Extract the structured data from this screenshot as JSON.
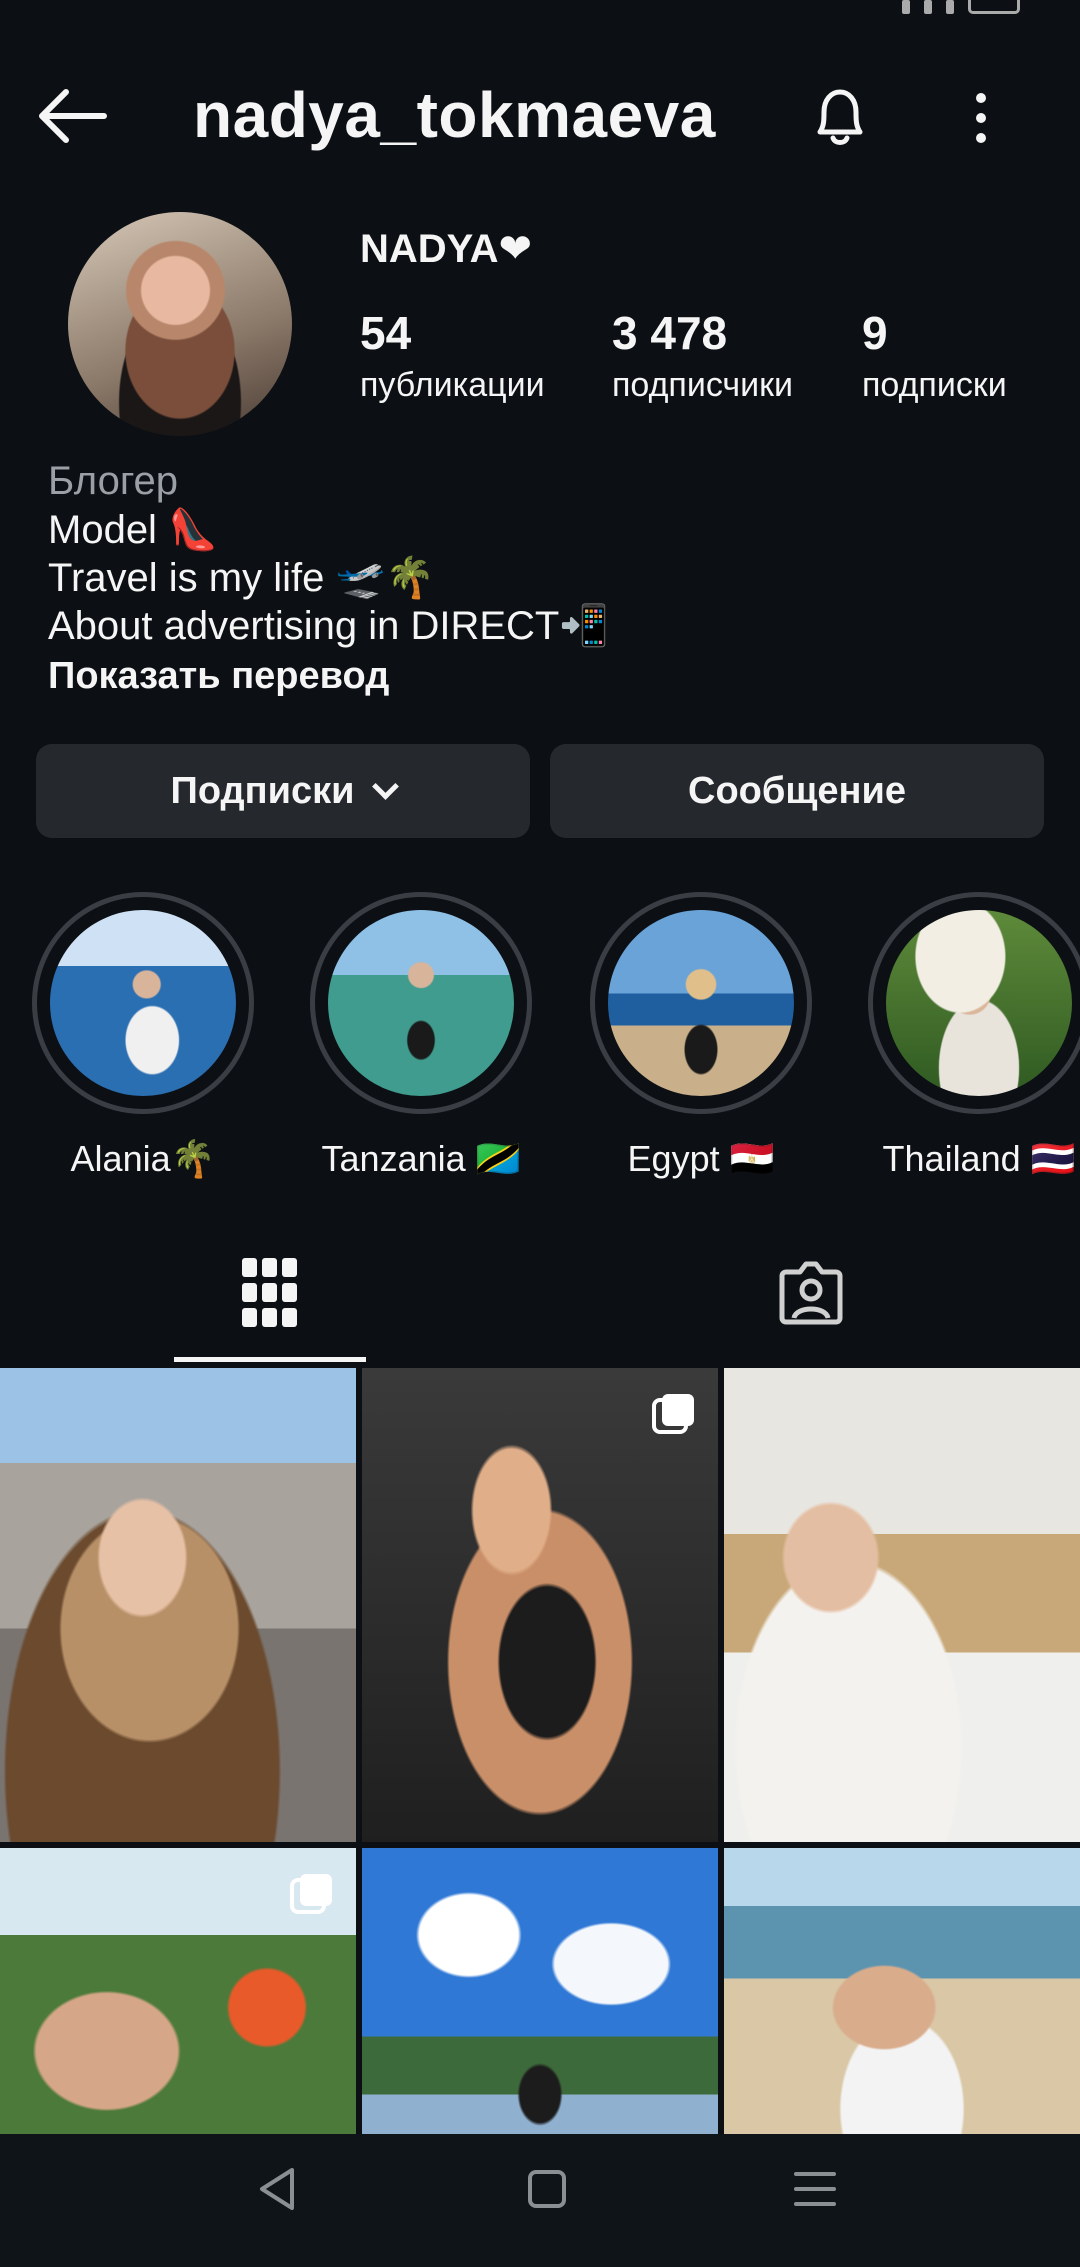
{
  "header": {
    "username": "nadya_tokmaeva",
    "back_icon": "back-arrow-icon",
    "bell_icon": "bell-icon",
    "more_icon": "more-vertical-icon"
  },
  "profile": {
    "display_name": "NADYA❤",
    "stats": {
      "posts_count": "54",
      "posts_label": "публикации",
      "followers_count": "3 478",
      "followers_label": "подписчики",
      "following_count": "9",
      "following_label": "подписки"
    }
  },
  "bio": {
    "category": "Блогер",
    "line1": "Model 👠",
    "line2": "Travel is my life 🛫🌴",
    "line3": "About advertising in DIRECT📲",
    "translate": "Показать перевод"
  },
  "actions": {
    "following_label": "Подписки",
    "message_label": "Сообщение"
  },
  "highlights": [
    {
      "label": "Alania🌴"
    },
    {
      "label": "Tanzania 🇹🇿"
    },
    {
      "label": "Egypt 🇪🇬"
    },
    {
      "label": "Thailand 🇹🇭"
    }
  ],
  "tabs": {
    "grid_icon": "grid-icon",
    "tagged_icon": "tagged-person-icon"
  },
  "colors": {
    "background": "#0c1014",
    "button": "#25292e",
    "text": "#f5f5f5",
    "muted": "#9aa0a6"
  }
}
